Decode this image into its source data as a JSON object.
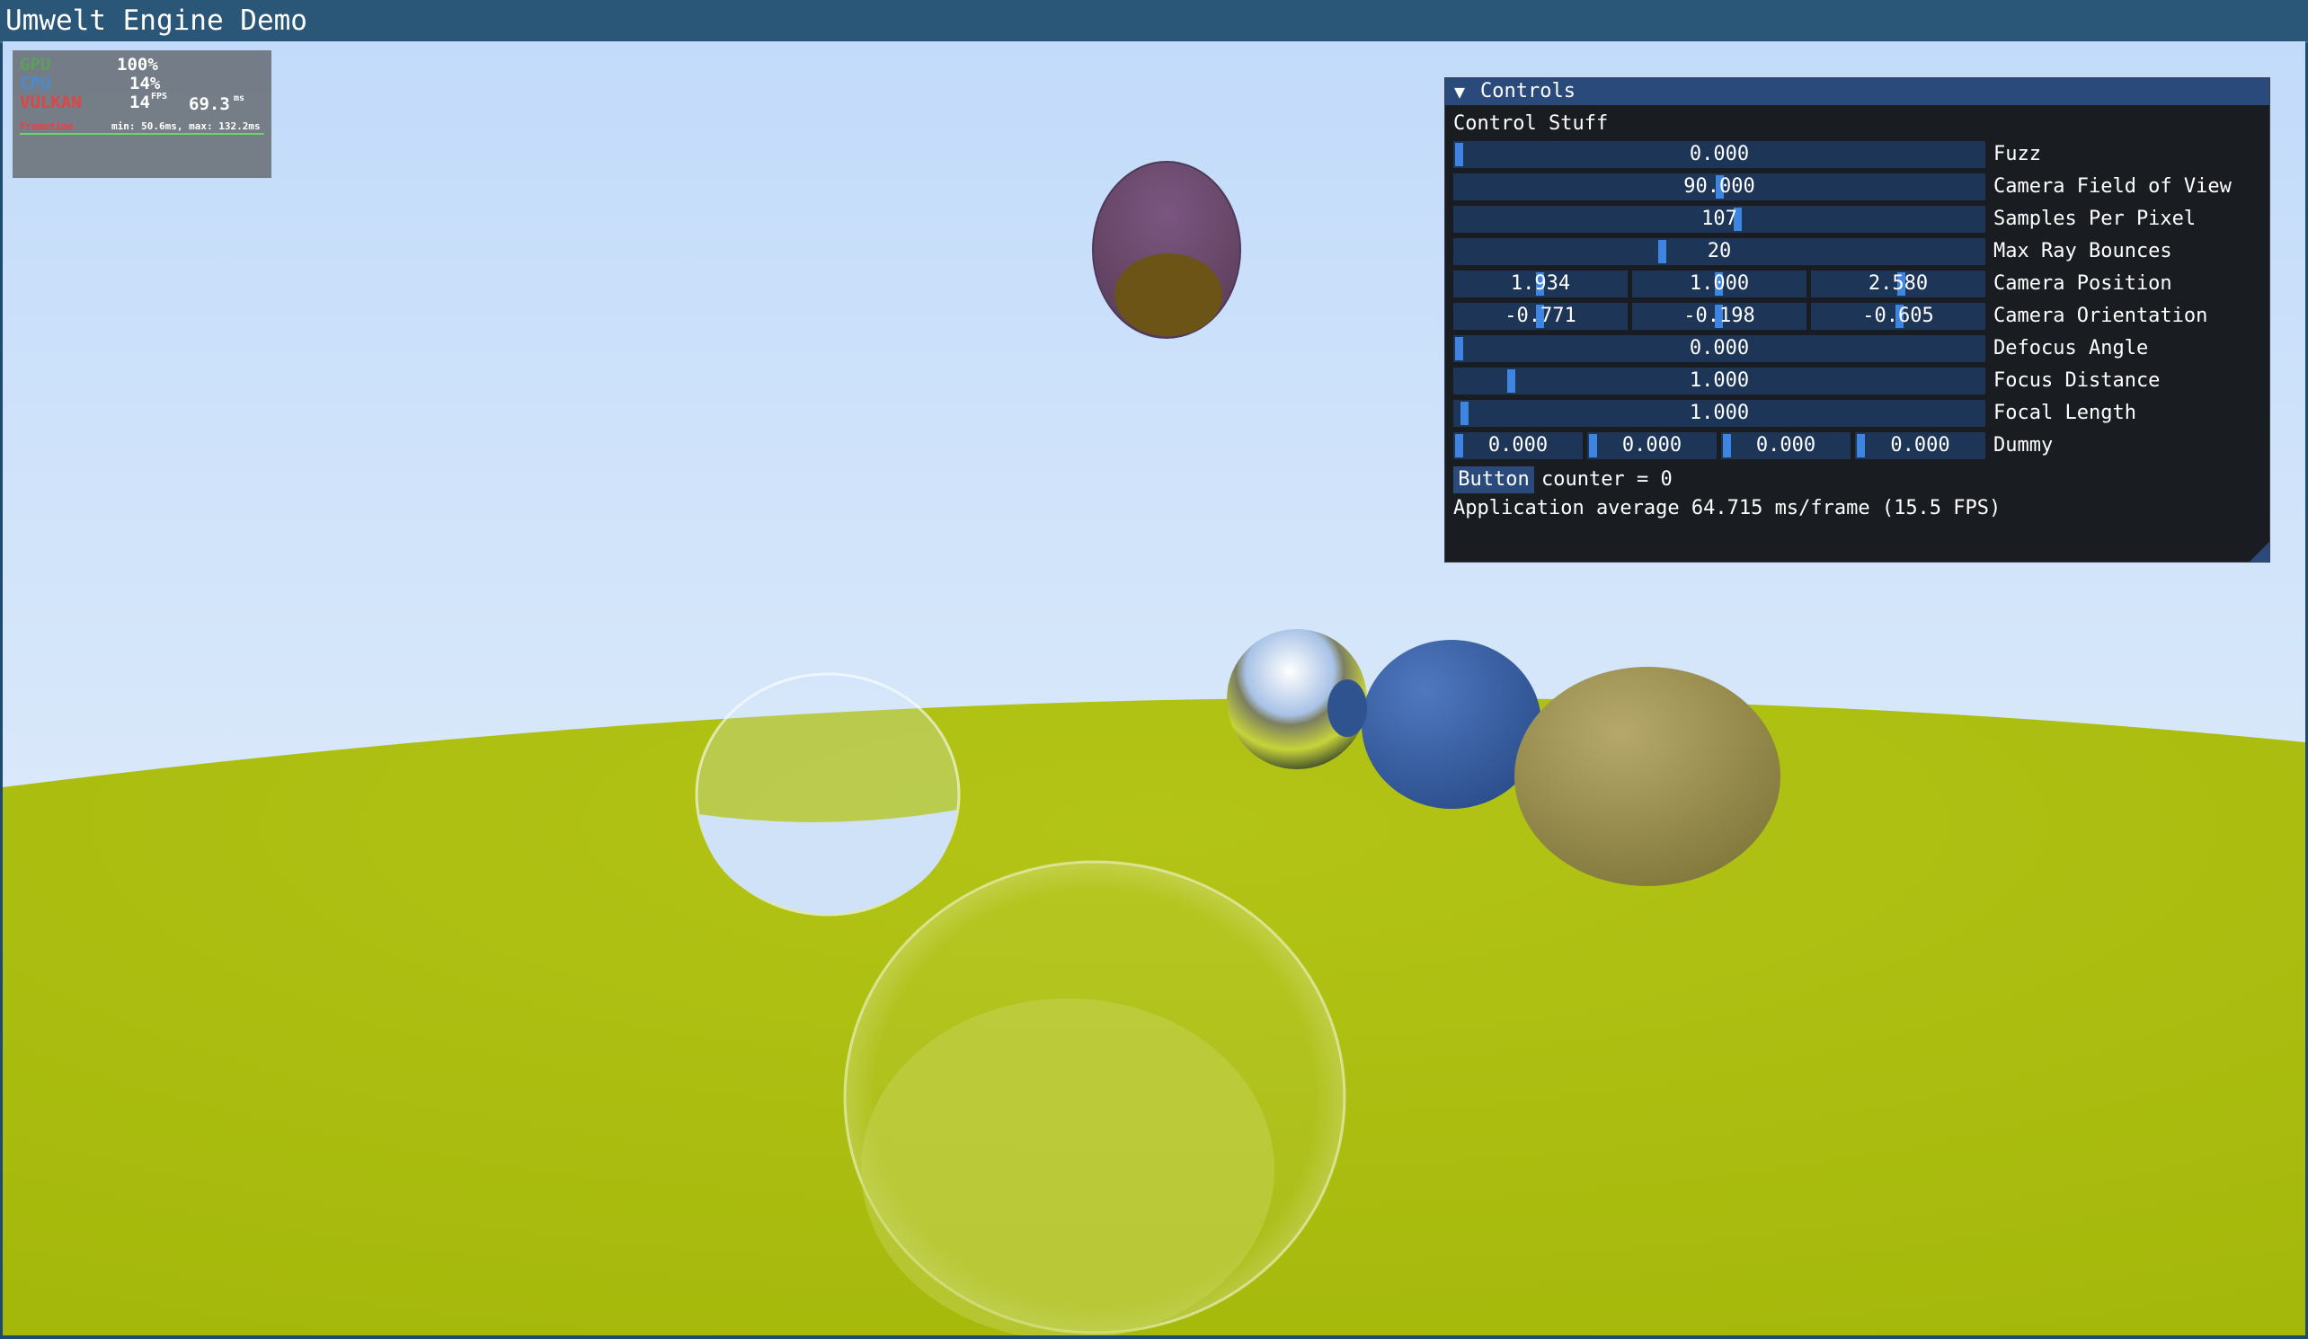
{
  "window": {
    "title": "Umwelt Engine Demo"
  },
  "perf_overlay": {
    "gpu_label": "GPU",
    "gpu_value": "100%",
    "cpu_label": "CPU",
    "cpu_value": "14%",
    "api_label": "VULKAN",
    "fps_value": "14",
    "fps_unit": "FPS",
    "frametime_value": "69.3",
    "frametime_unit": "ms",
    "frametime_label": "Frametime",
    "minmax_text": "min: 50.6ms, max: 132.2ms",
    "colors": {
      "gpu": "#5aa05a",
      "cpu": "#4a8ad0",
      "api": "#e04545"
    }
  },
  "controls": {
    "title": "Controls",
    "header_text": "Control Stuff",
    "rows": [
      {
        "label": "Fuzz",
        "values": [
          "0.000"
        ]
      },
      {
        "label": "Camera Field of View",
        "values": [
          "90.000"
        ]
      },
      {
        "label": "Samples Per Pixel",
        "values": [
          "107"
        ]
      },
      {
        "label": "Max Ray Bounces",
        "values": [
          "20"
        ]
      },
      {
        "label": "Camera Position",
        "values": [
          "1.934",
          "1.000",
          "2.580"
        ]
      },
      {
        "label": "Camera Orientation",
        "values": [
          "-0.771",
          "-0.198",
          "-0.605"
        ]
      },
      {
        "label": "Defocus Angle",
        "values": [
          "0.000"
        ]
      },
      {
        "label": "Focus Distance",
        "values": [
          "1.000"
        ]
      },
      {
        "label": "Focal Length",
        "values": [
          "1.000"
        ]
      },
      {
        "label": "Dummy",
        "values": [
          "0.000",
          "0.000",
          "0.000",
          "0.000"
        ]
      }
    ],
    "button_label": "Button",
    "counter_text": "counter = 0",
    "average_text": "Application average 64.715 ms/frame (15.5 FPS)",
    "colors": {
      "frame_bg": "#1d3556",
      "grab": "#3d85e0",
      "header": "#294a7a"
    }
  },
  "scene": {
    "sky_top": "#c4dcfa",
    "sky_bottom": "#e8f1fb",
    "ground": "#a9bd0c"
  }
}
